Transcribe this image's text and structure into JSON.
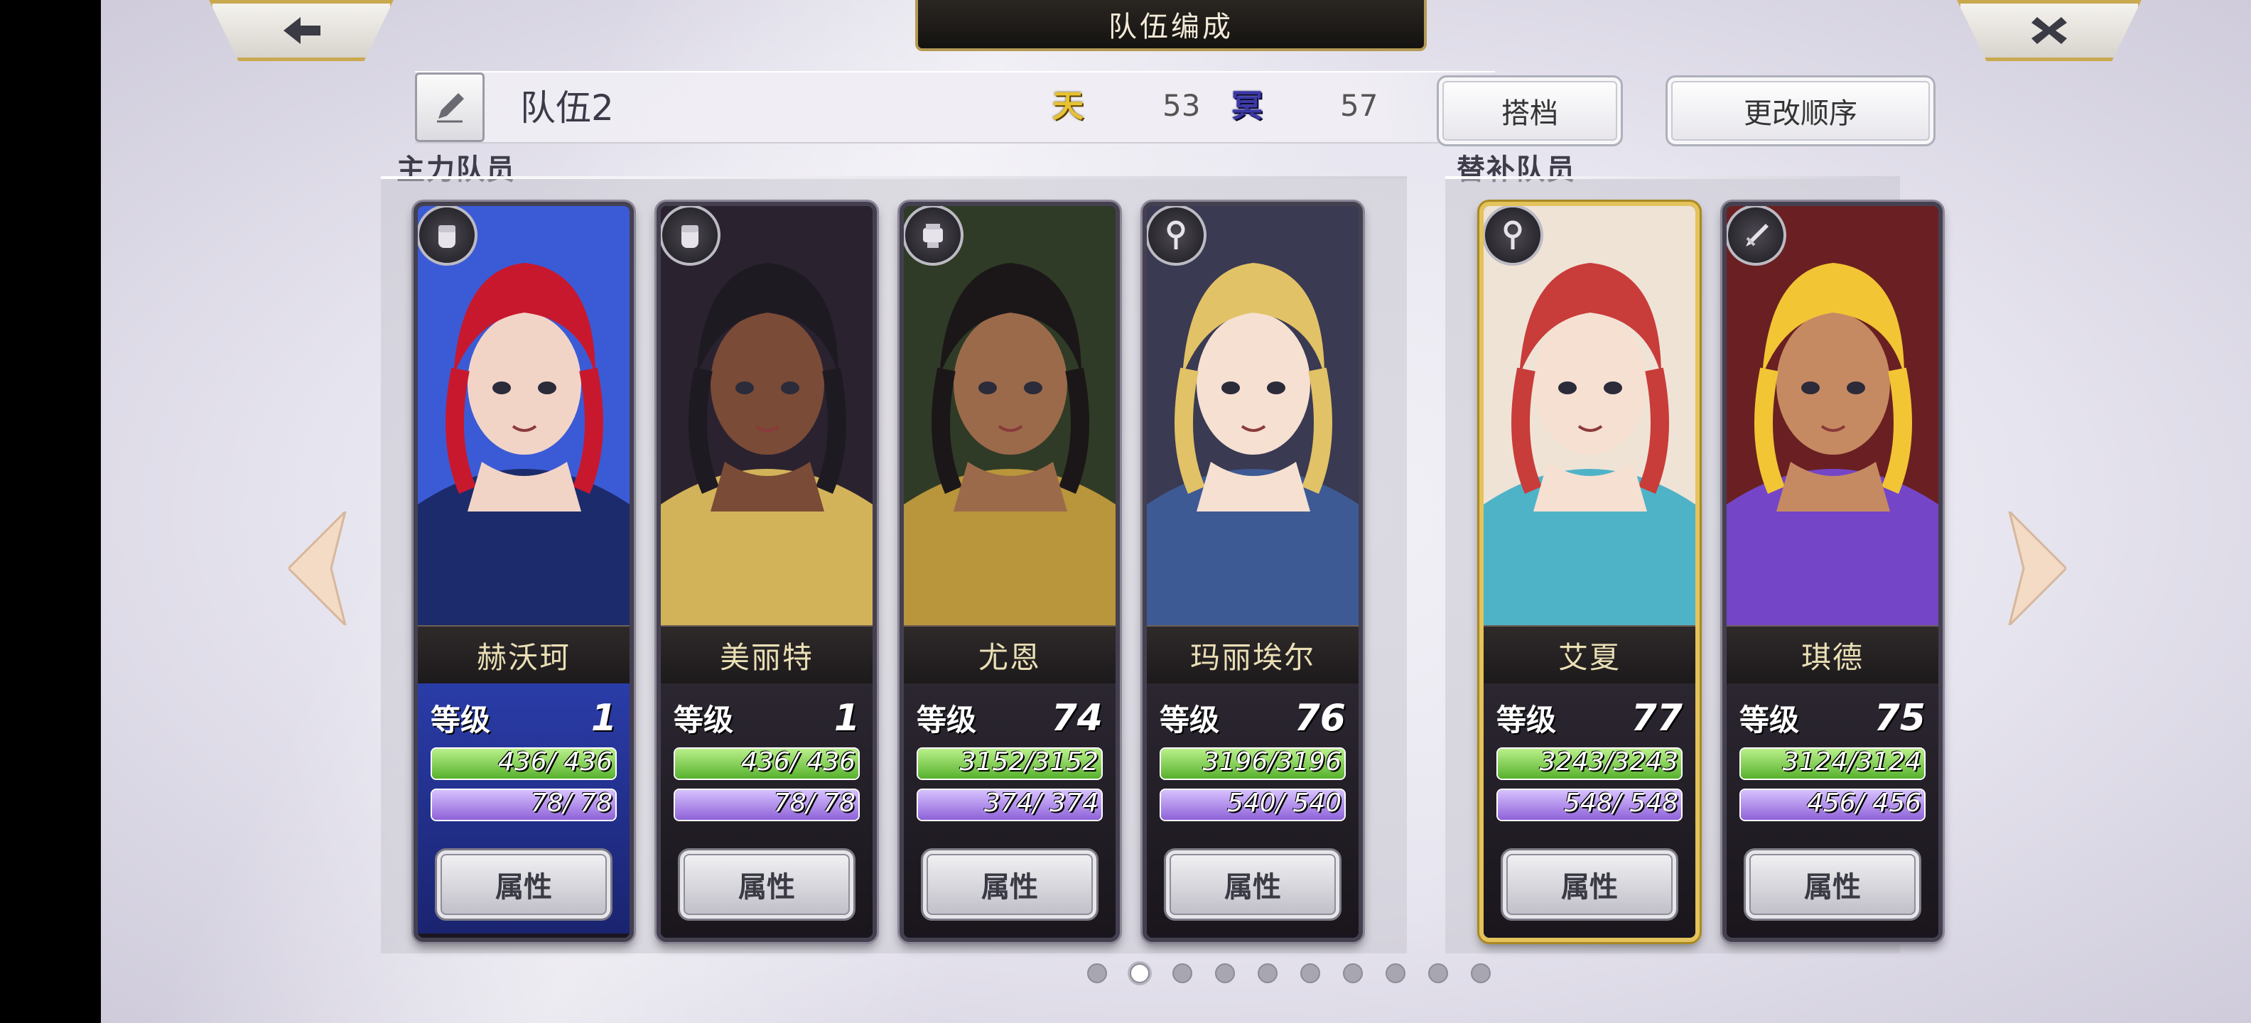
{
  "header": {
    "title": "队伍编成",
    "back_icon": "back-arrow-icon",
    "close_icon": "close-icon"
  },
  "team": {
    "name": "队伍2",
    "stat_ten_icon": "天",
    "stat_ten_value": "53",
    "stat_mei_icon": "冥",
    "stat_mei_value": "57",
    "partner_button": "搭档",
    "reorder_button": "更改顺序"
  },
  "sections": {
    "main_label": "主力队员",
    "reserve_label": "替补队员"
  },
  "characters": [
    {
      "name": "赫沃珂",
      "level_label": "等级",
      "level": "1",
      "hp_text": "436/ 436",
      "mp_text": "78/ 78",
      "hp_fill": 1.0,
      "mp_fill": 1.0,
      "role_icon": "fist-icon",
      "button": "属性"
    },
    {
      "name": "美丽特",
      "level_label": "等级",
      "level": "1",
      "hp_text": "436/ 436",
      "mp_text": "78/ 78",
      "hp_fill": 1.0,
      "mp_fill": 1.0,
      "role_icon": "fist-icon",
      "button": "属性"
    },
    {
      "name": "尤恩",
      "level_label": "等级",
      "level": "74",
      "hp_text": "3152/3152",
      "mp_text": "374/ 374",
      "hp_fill": 1.0,
      "mp_fill": 1.0,
      "role_icon": "gauntlet-icon",
      "button": "属性"
    },
    {
      "name": "玛丽埃尔",
      "level_label": "等级",
      "level": "76",
      "hp_text": "3196/3196",
      "mp_text": "540/ 540",
      "hp_fill": 1.0,
      "mp_fill": 1.0,
      "role_icon": "staff-icon",
      "button": "属性"
    },
    {
      "name": "艾夏",
      "level_label": "等级",
      "level": "77",
      "hp_text": "3243/3243",
      "mp_text": "548/ 548",
      "hp_fill": 1.0,
      "mp_fill": 1.0,
      "role_icon": "staff-icon",
      "button": "属性"
    },
    {
      "name": "琪德",
      "level_label": "等级",
      "level": "75",
      "hp_text": "3124/3124",
      "mp_text": "456/ 456",
      "hp_fill": 1.0,
      "mp_fill": 1.0,
      "role_icon": "sword-icon",
      "button": "属性"
    }
  ],
  "pagination": {
    "total": 10,
    "active": 2
  },
  "colors": {
    "accent_gold": "#e4c35c",
    "hp_green": "#57b12d",
    "mp_purple": "#8e62d8"
  }
}
